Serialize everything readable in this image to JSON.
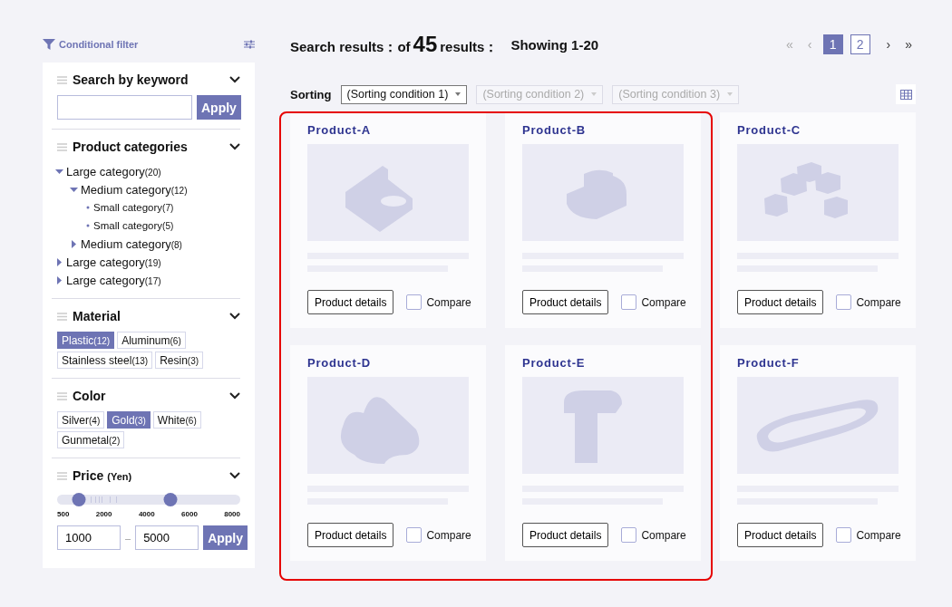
{
  "sidebar": {
    "title": "Conditional filter",
    "keyword": {
      "title": "Search by keyword",
      "expanded": true,
      "button": "Apply"
    },
    "categories": {
      "title": "Product categories",
      "expanded": true,
      "items": [
        {
          "label": "Large category",
          "count": "(20)",
          "expanded": true,
          "children": [
            {
              "label": "Medium category",
              "count": "(12)",
              "expanded": true,
              "children": [
                {
                  "label": "Small category",
                  "count": "(7)"
                },
                {
                  "label": "Small category",
                  "count": "(5)"
                }
              ]
            },
            {
              "label": "Medium category",
              "count": "(8)",
              "expanded": false
            }
          ]
        },
        {
          "label": "Large category",
          "count": "(19)",
          "expanded": false
        },
        {
          "label": "Large category",
          "count": "(17)",
          "expanded": false
        }
      ]
    },
    "material": {
      "title": "Material",
      "expanded": true,
      "chips": [
        {
          "label": "Plastic",
          "count": "(12)",
          "selected": true
        },
        {
          "label": "Aluminum",
          "count": "(6)",
          "selected": false
        },
        {
          "label": "Stainless steel",
          "count": "(13)",
          "selected": false
        },
        {
          "label": "Resin",
          "count": "(3)",
          "selected": false
        }
      ]
    },
    "color": {
      "title": "Color",
      "expanded": true,
      "chips": [
        {
          "label": "Silver",
          "count": "(4)",
          "selected": false
        },
        {
          "label": "Gold",
          "count": "(3)",
          "selected": true
        },
        {
          "label": "White",
          "count": "(6)",
          "selected": false
        },
        {
          "label": "Gunmetal",
          "count": "(2)",
          "selected": false
        }
      ]
    },
    "price": {
      "title": "Price",
      "unit": "(Yen)",
      "expanded": true,
      "low": {
        "level": 0.12
      },
      "high": {
        "level": 0.62
      },
      "ticks": [
        "500",
        "2000",
        "4000",
        "6000",
        "8000"
      ],
      "min_value": "1000",
      "separator": "–",
      "max_value": "5000",
      "button": "Apply"
    }
  },
  "results": {
    "prefix": "Search results：of",
    "count": "45",
    "suffix": "results：",
    "range": "Showing 1-20"
  },
  "pagination": {
    "first": "«",
    "prev": "‹",
    "pages": [
      {
        "label": "1",
        "selected": true
      },
      {
        "label": "2",
        "selected": false
      }
    ],
    "next": "›",
    "last": "»"
  },
  "sorting": {
    "label": "Sorting",
    "selects": [
      {
        "value": "(Sorting condition 1)",
        "disabled": false
      },
      {
        "value": "(Sorting condition 2)",
        "disabled": true
      },
      {
        "value": "(Sorting condition 3)",
        "disabled": true
      }
    ]
  },
  "products": [
    {
      "name": "Product-A",
      "button": "Product details",
      "compare": "Compare",
      "checked": false
    },
    {
      "name": "Product-B",
      "button": "Product details",
      "compare": "Compare",
      "checked": false
    },
    {
      "name": "Product-C",
      "button": "Product details",
      "compare": "Compare",
      "checked": false
    },
    {
      "name": "Product-D",
      "button": "Product details",
      "compare": "Compare",
      "checked": false
    },
    {
      "name": "Product-E",
      "button": "Product details",
      "compare": "Compare",
      "checked": false
    },
    {
      "name": "Product-F",
      "button": "Product details",
      "compare": "Compare",
      "checked": false
    }
  ]
}
